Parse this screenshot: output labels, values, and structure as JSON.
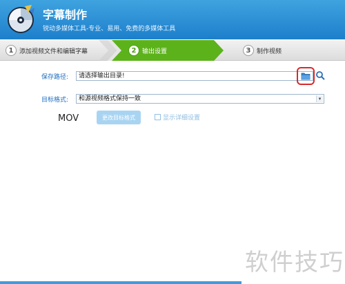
{
  "header": {
    "title": "字幕制作",
    "subtitle": "锐动多媒体工具-专业、易用、免费的多媒体工具"
  },
  "steps": [
    {
      "number": "1",
      "label": "添加视频文件和编辑字幕",
      "active": false
    },
    {
      "number": "2",
      "label": "输出设置",
      "active": true
    },
    {
      "number": "3",
      "label": "制作视频",
      "active": false
    }
  ],
  "form": {
    "save_path_label": "保存路径:",
    "save_path_value": "请选择输出目录!",
    "target_format_label": "目标格式:",
    "target_format_value": "和源视频格式保持一致",
    "format_name": "MOV",
    "change_format_button": "更改目标格式",
    "show_details_label": "显示详细设置",
    "show_details_checked": false
  },
  "icons": {
    "logo": "cd-disc-logo-icon",
    "folder": "folder-icon",
    "search": "search-icon",
    "dropdown": "dropdown-arrow-icon"
  },
  "watermark": "软件技巧",
  "colors": {
    "header": "#2a8dd6",
    "active_step": "#5cb21b",
    "label": "#1f6fbf",
    "highlight": "#d62a2a"
  }
}
